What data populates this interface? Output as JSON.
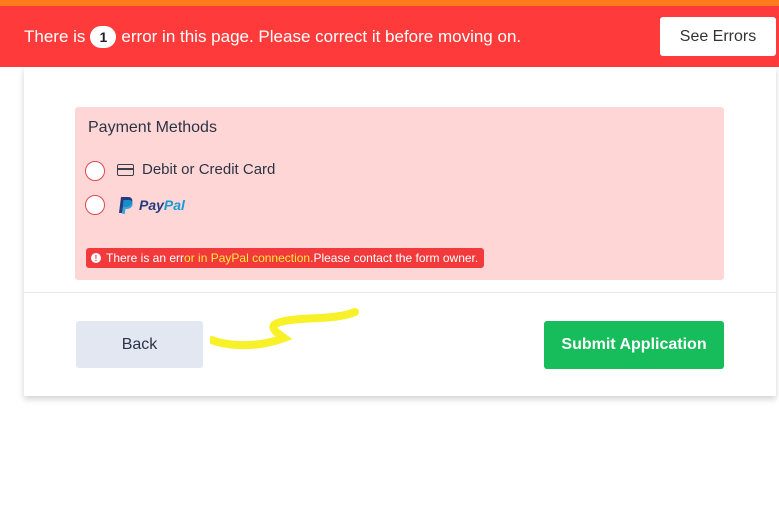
{
  "banner": {
    "prefix": "There is",
    "error_count": "1",
    "suffix": "error in this page. Please correct it before moving on.",
    "see_errors_label": "See Errors",
    "accent_color": "#ff7a1a",
    "background_color": "#ff3a3a"
  },
  "payment": {
    "title": "Payment Methods",
    "options": [
      {
        "label": "Debit or Credit Card",
        "icon": "credit-card-icon"
      },
      {
        "label": "PayPal",
        "icon": "paypal-logo"
      }
    ],
    "paypal_logo_text": {
      "pay": "Pay",
      "pal": "Pal"
    },
    "error": {
      "icon": "exclamation-circle-icon",
      "before": "There is an err",
      "highlighted": "or in PayPal connection.",
      "after": " Please contact the form owner."
    }
  },
  "buttons": {
    "back_label": "Back",
    "submit_label": "Submit Application",
    "submit_color": "#18bd5b"
  }
}
